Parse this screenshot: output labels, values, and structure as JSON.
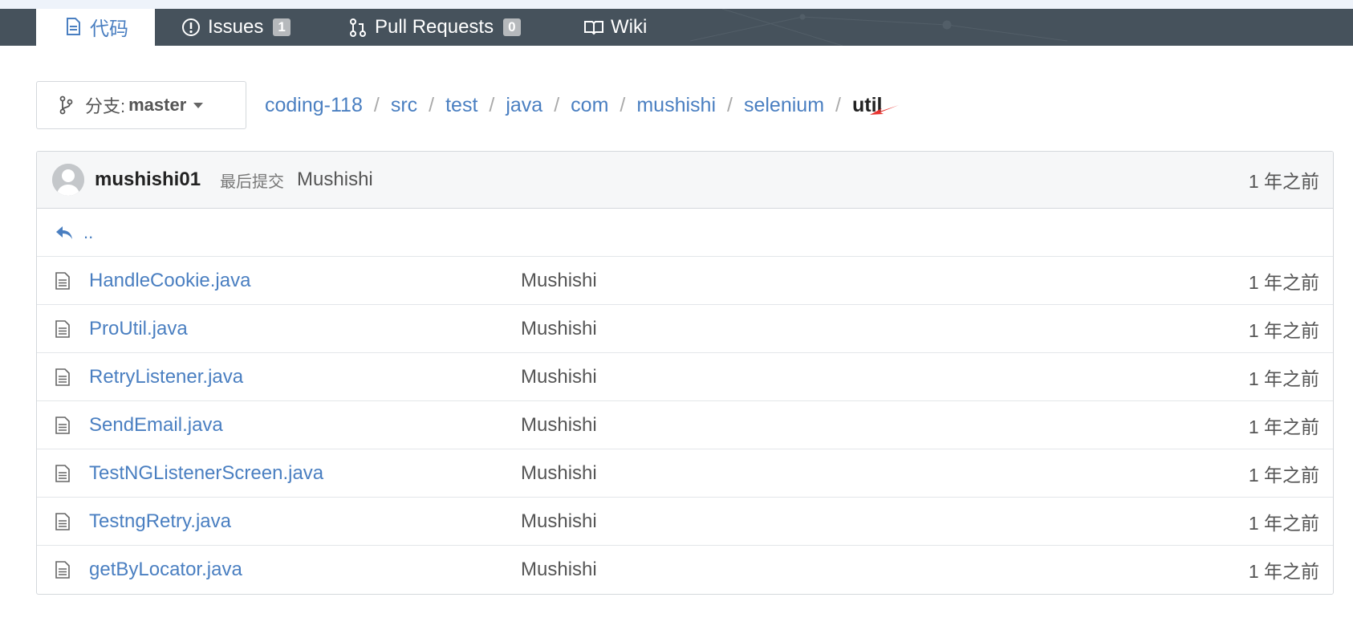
{
  "nav": {
    "tabs": [
      {
        "label": "代码",
        "icon": "file-icon",
        "active": true
      },
      {
        "label": "Issues",
        "icon": "issue-icon",
        "badge": "1"
      },
      {
        "label": "Pull Requests",
        "icon": "pull-request-icon",
        "badge": "0"
      },
      {
        "label": "Wiki",
        "icon": "book-icon"
      }
    ]
  },
  "branch": {
    "prefix": "分支:",
    "name": "master",
    "icon": "branch-icon"
  },
  "breadcrumb": {
    "items": [
      "coding-118",
      "src",
      "test",
      "java",
      "com",
      "mushishi",
      "selenium"
    ],
    "current": "util",
    "separator": "/"
  },
  "commit": {
    "user": "mushishi01",
    "label": "最后提交",
    "message": "Mushishi",
    "time": "1 年之前"
  },
  "parent_link": "..",
  "files": [
    {
      "name": "HandleCookie.java",
      "author": "Mushishi",
      "time": "1 年之前"
    },
    {
      "name": "ProUtil.java",
      "author": "Mushishi",
      "time": "1 年之前"
    },
    {
      "name": "RetryListener.java",
      "author": "Mushishi",
      "time": "1 年之前"
    },
    {
      "name": "SendEmail.java",
      "author": "Mushishi",
      "time": "1 年之前"
    },
    {
      "name": "TestNGListenerScreen.java",
      "author": "Mushishi",
      "time": "1 年之前"
    },
    {
      "name": "TestngRetry.java",
      "author": "Mushishi",
      "time": "1 年之前"
    },
    {
      "name": "getByLocator.java",
      "author": "Mushishi",
      "time": "1 年之前"
    }
  ],
  "colors": {
    "link": "#4a7fc1",
    "navbar": "#46525c",
    "annotation": "#e8322e"
  }
}
